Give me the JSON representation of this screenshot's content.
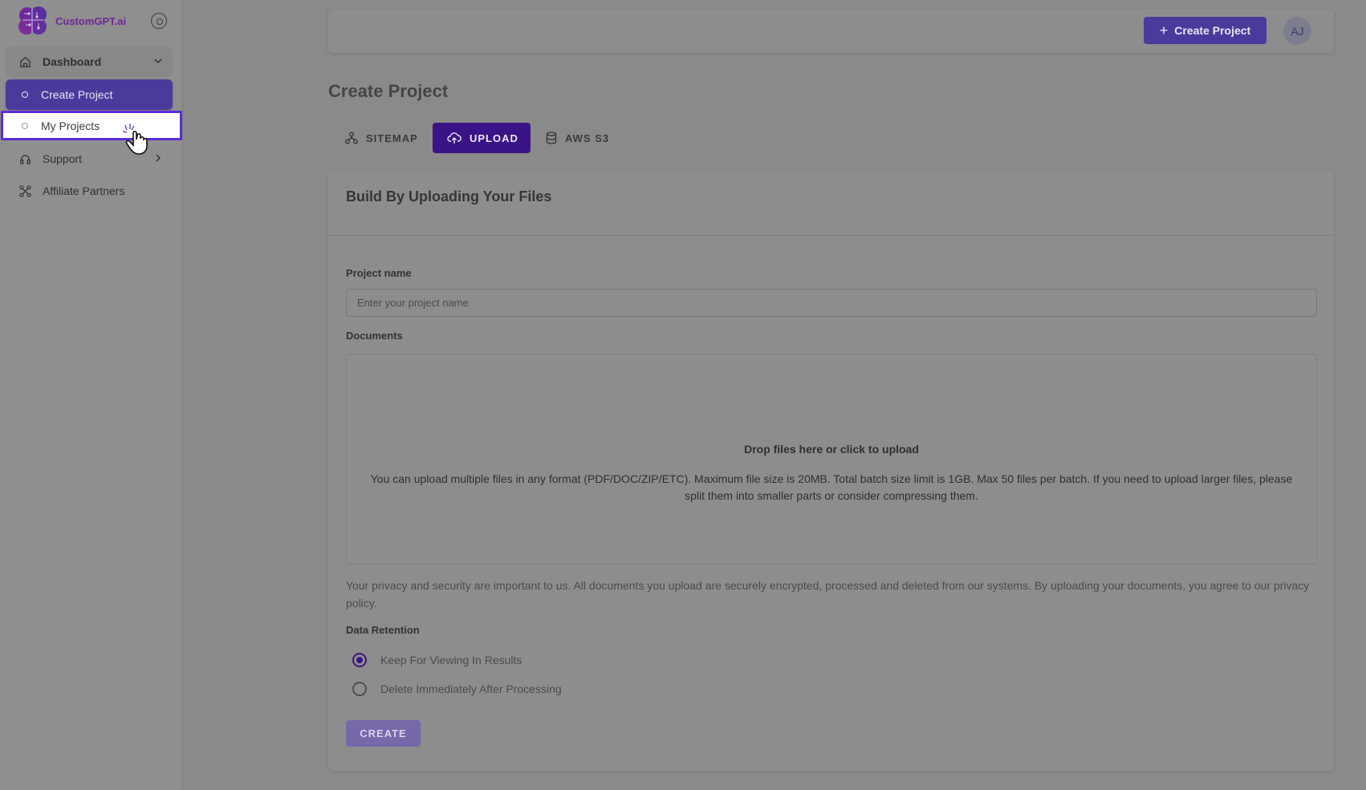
{
  "brand": {
    "name": "CustomGPT.ai",
    "logo_icon": "brain-logo-icon"
  },
  "sidebar": {
    "items": [
      {
        "label": "Dashboard",
        "icon": "home-icon"
      },
      {
        "label": "Create Project",
        "icon": "circle-icon"
      },
      {
        "label": "My Projects",
        "icon": "circle-icon"
      },
      {
        "label": "Support",
        "icon": "headset-icon"
      },
      {
        "label": "Affiliate Partners",
        "icon": "network-icon"
      }
    ]
  },
  "header": {
    "create_label": "Create Project",
    "avatar_initials": "AJ"
  },
  "page": {
    "title": "Create Project"
  },
  "tabs": [
    {
      "label": "SITEMAP",
      "icon": "sitemap-icon"
    },
    {
      "label": "UPLOAD",
      "icon": "cloud-upload-icon",
      "active": true
    },
    {
      "label": "AWS S3",
      "icon": "database-icon"
    }
  ],
  "form": {
    "section_title": "Build By Uploading Your Files",
    "project_name_label": "Project name",
    "project_name_placeholder": "Enter your project name",
    "project_name_value": "",
    "documents_label": "Documents",
    "drop_title": "Drop files here or click to upload",
    "drop_desc": "You can upload multiple files in any format (PDF/DOC/ZIP/ETC). Maximum file size is 20MB. Total batch size limit is 1GB. Max 50 files per batch. If you need to upload larger files, please split them into smaller parts or consider compressing them.",
    "privacy_text": "Your privacy and security are important to us. All documents you upload are securely encrypted, processed and deleted from our systems. By uploading your documents, you agree to our privacy policy.",
    "retention_label": "Data Retention",
    "retention_options": [
      {
        "label": "Keep For Viewing In Results",
        "selected": true
      },
      {
        "label": "Delete Immediately After Processing",
        "selected": false
      }
    ],
    "submit_label": "CREATE"
  },
  "colors": {
    "accent": "#4b3a9c",
    "active_tab": "#3a1486",
    "highlight_border": "#5c2dd6",
    "brand_text": "#6d2796"
  }
}
